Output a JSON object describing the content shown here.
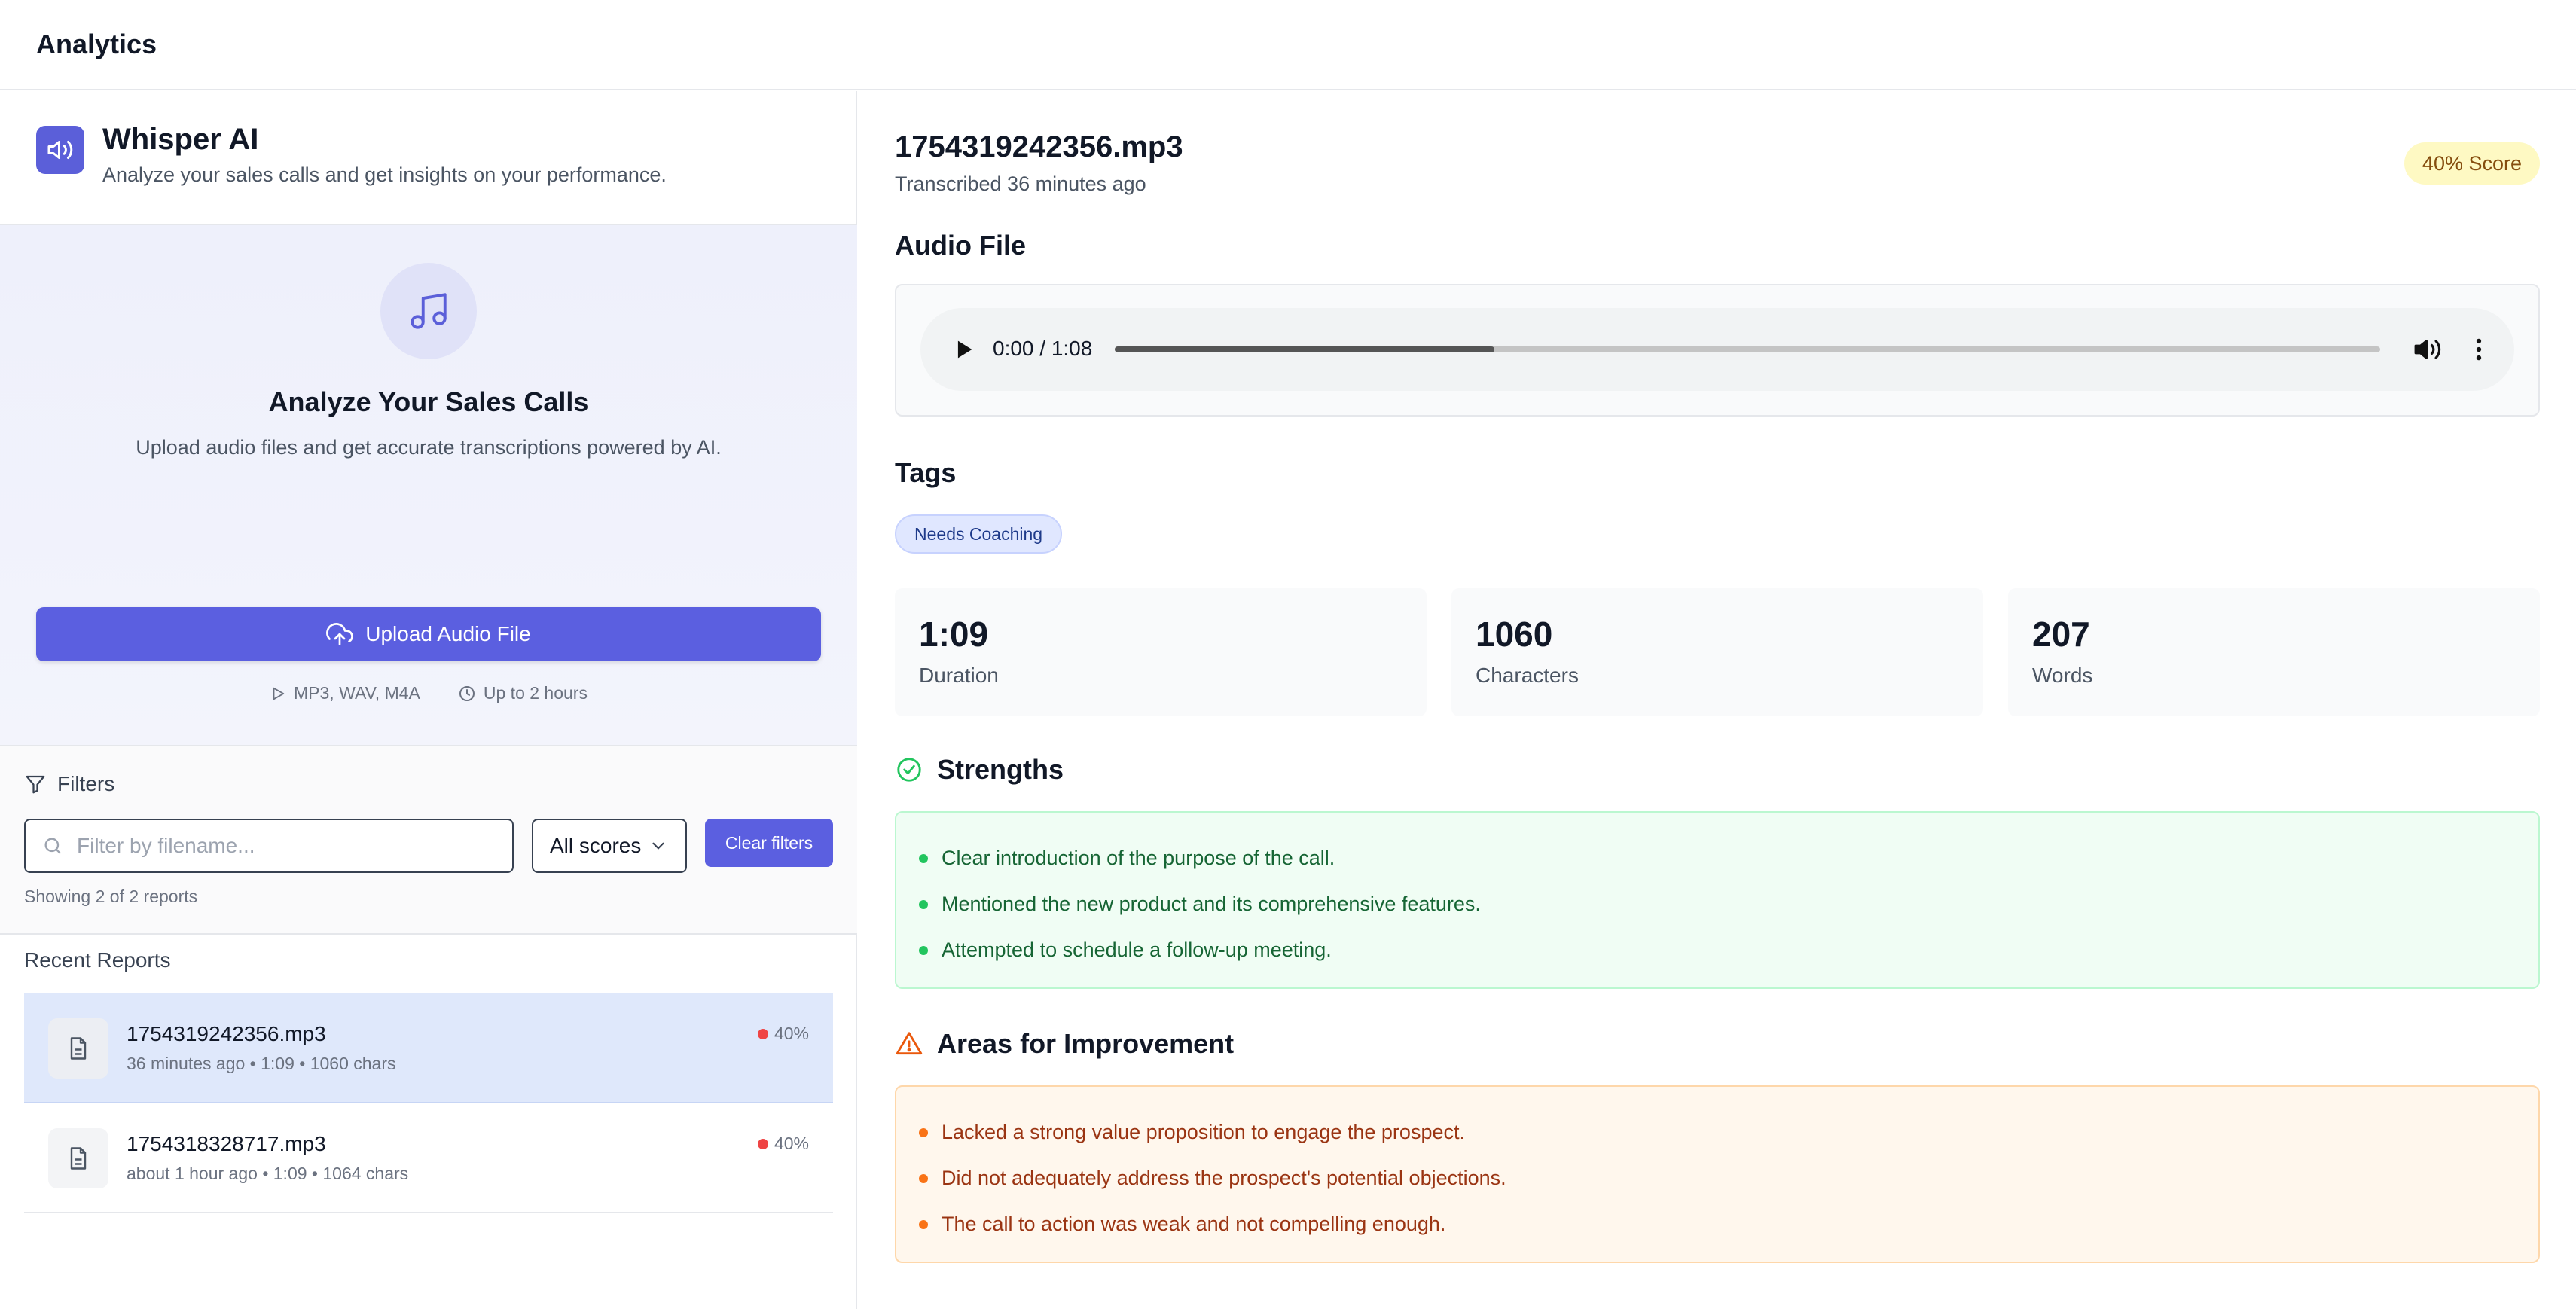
{
  "app": {
    "title": "Analytics"
  },
  "brand": {
    "name": "Whisper AI",
    "tagline": "Analyze your sales calls and get insights on your performance."
  },
  "hero": {
    "title": "Analyze Your Sales Calls",
    "subtitle": "Upload audio files and get accurate transcriptions powered by AI.",
    "upload_label": "Upload Audio File",
    "formats": "MP3, WAV, M4A",
    "limit": "Up to 2 hours"
  },
  "filters": {
    "label": "Filters",
    "search_placeholder": "Filter by filename...",
    "score_selected": "All scores",
    "clear_label": "Clear filters",
    "showing": "Showing 2 of 2 reports"
  },
  "recent": {
    "title": "Recent Reports",
    "items": [
      {
        "name": "1754319242356.mp3",
        "meta": "36 minutes ago • 1:09 • 1060 chars",
        "score": "40%"
      },
      {
        "name": "1754318328717.mp3",
        "meta": "about 1 hour ago • 1:09 • 1064 chars",
        "score": "40%"
      }
    ]
  },
  "detail": {
    "filename": "1754319242356.mp3",
    "transcribed": "Transcribed 36 minutes ago",
    "score_badge": "40% Score",
    "audio_title": "Audio File",
    "player": {
      "time": "0:00 / 1:08",
      "progress_fraction": 0.3
    },
    "tags_title": "Tags",
    "tags": [
      "Needs Coaching"
    ],
    "stats": [
      {
        "value": "1:09",
        "label": "Duration"
      },
      {
        "value": "1060",
        "label": "Characters"
      },
      {
        "value": "207",
        "label": "Words"
      }
    ],
    "strengths_title": "Strengths",
    "strengths": [
      "Clear introduction of the purpose of the call.",
      "Mentioned the new product and its comprehensive features.",
      "Attempted to schedule a follow-up meeting."
    ],
    "improve_title": "Areas for Improvement",
    "improvements": [
      "Lacked a strong value proposition to engage the prospect.",
      "Did not adequately address the prospect's potential objections.",
      "The call to action was weak and not compelling enough."
    ]
  },
  "colors": {
    "accent": "#5b5fe0",
    "score_dot": "#ef4444",
    "strength": "#22c55e",
    "improve": "#f97316"
  }
}
